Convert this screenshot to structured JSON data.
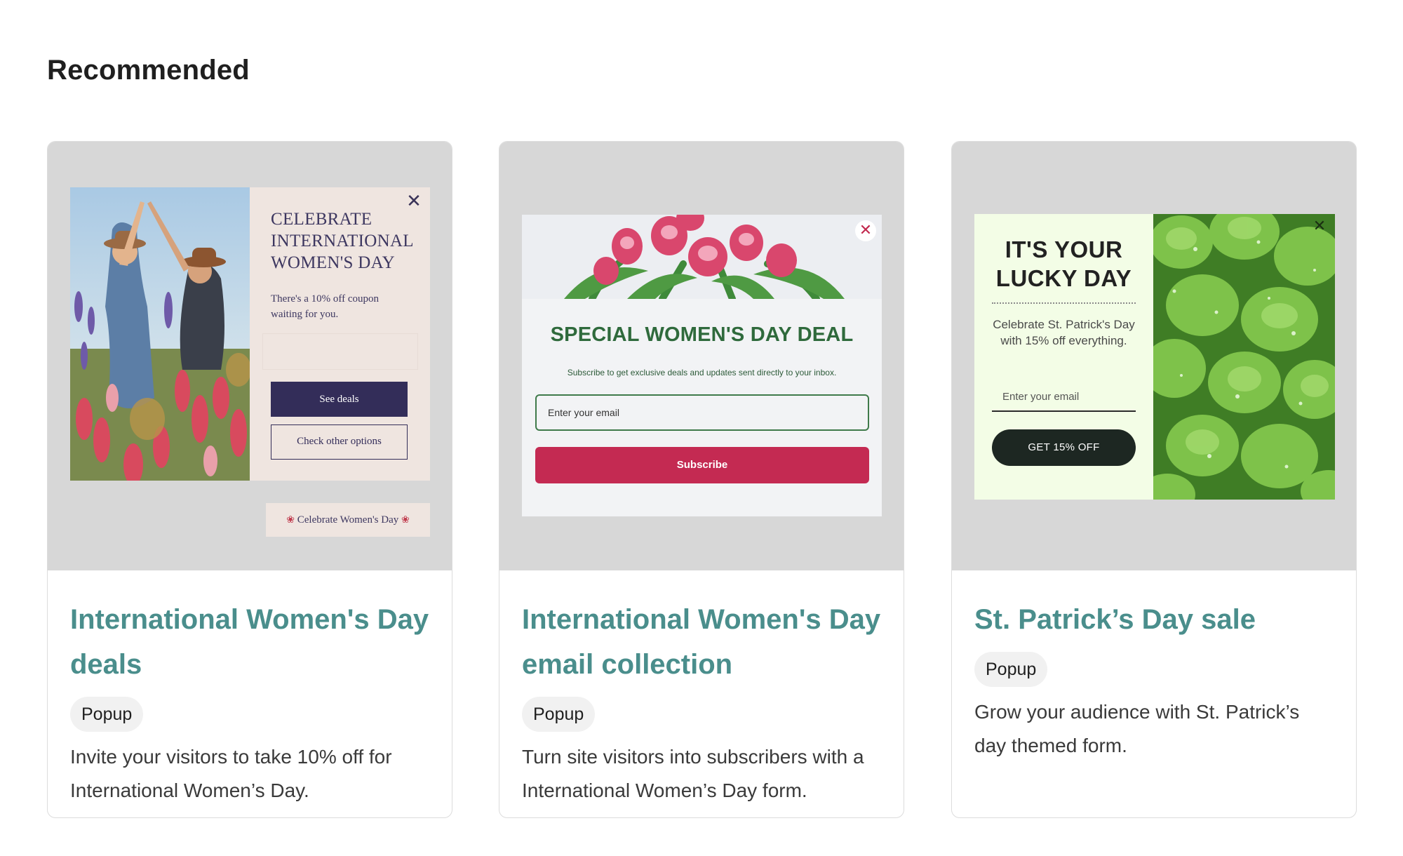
{
  "section": {
    "title": "Recommended"
  },
  "cards": [
    {
      "title": "International Women's Day deals",
      "tag": "Popup",
      "description": "Invite your visitors to take 10% off for International Women’s Day.",
      "preview": {
        "headline": "CELEBRATE INTERNATIONAL WOMEN'S DAY",
        "subtext": "There's a 10% off coupon waiting for you.",
        "primary_button": "See deals",
        "secondary_button": "Check other options",
        "teaser": "Celebrate Women's Day",
        "close_icon": "close-icon"
      }
    },
    {
      "title": "International Women's Day email collection",
      "tag": "Popup",
      "description": "Turn site visitors into subscribers with a International Women’s Day form.",
      "preview": {
        "headline": "SPECIAL WOMEN'S DAY DEAL",
        "subtext": "Subscribe to get exclusive deals and updates sent directly to your inbox.",
        "email_placeholder": "Enter your email",
        "button": "Subscribe",
        "close_icon": "close-icon"
      }
    },
    {
      "title": "St. Patrick’s Day sale",
      "tag": "Popup",
      "description": "Grow your audience with St. Patrick’s day themed form.",
      "preview": {
        "headline": "IT'S YOUR LUCKY DAY",
        "subtext": "Celebrate St. Patrick's Day with 15% off everything.",
        "email_placeholder": "Enter your email",
        "button": "GET 15% OFF",
        "close_icon": "close-icon"
      }
    }
  ],
  "colors": {
    "title_teal": "#4a8e8c",
    "preview_bg": "#d7d7d7",
    "womens_purple": "#332d59",
    "deal_green": "#2f6a3c",
    "subscribe_red": "#c42a52",
    "clover_green": "#4f8e2e"
  }
}
